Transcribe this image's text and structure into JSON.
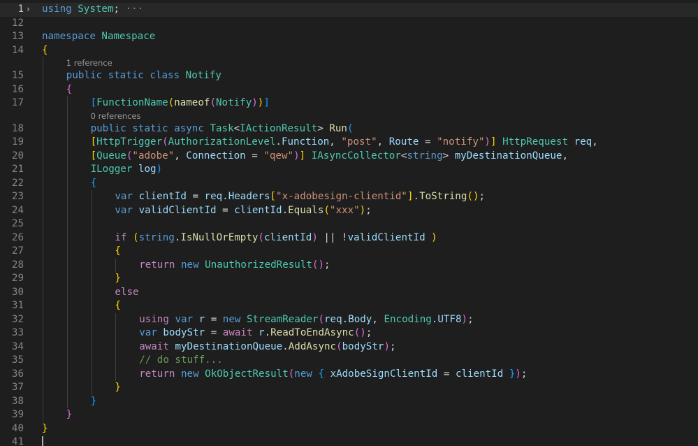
{
  "editor": {
    "lines": [
      {
        "no": "1",
        "fold": "›",
        "current": true,
        "indent": 0,
        "tokens": [
          [
            "kw",
            "using"
          ],
          [
            "pl",
            " "
          ],
          [
            "cls",
            "System"
          ],
          [
            "pl",
            ";"
          ],
          [
            "ell",
            " ···"
          ]
        ]
      },
      {
        "no": "12",
        "indent": 0,
        "tokens": []
      },
      {
        "no": "13",
        "indent": 0,
        "tokens": [
          [
            "kw",
            "namespace"
          ],
          [
            "pl",
            " "
          ],
          [
            "cls",
            "Namespace"
          ]
        ]
      },
      {
        "no": "14",
        "indent": 0,
        "tokens": [
          [
            "b1",
            "{"
          ]
        ]
      },
      {
        "lens": "1 reference",
        "indent": 1
      },
      {
        "no": "15",
        "indent": 1,
        "tokens": [
          [
            "kw",
            "public"
          ],
          [
            "pl",
            " "
          ],
          [
            "kw",
            "static"
          ],
          [
            "pl",
            " "
          ],
          [
            "kw",
            "class"
          ],
          [
            "pl",
            " "
          ],
          [
            "cls",
            "Notify"
          ]
        ]
      },
      {
        "no": "16",
        "indent": 1,
        "tokens": [
          [
            "b2",
            "{"
          ]
        ]
      },
      {
        "no": "17",
        "indent": 2,
        "tokens": [
          [
            "b3",
            "["
          ],
          [
            "cls",
            "FunctionName"
          ],
          [
            "b1",
            "("
          ],
          [
            "fn",
            "nameof"
          ],
          [
            "b2",
            "("
          ],
          [
            "cls",
            "Notify"
          ],
          [
            "b2",
            ")"
          ],
          [
            "b1",
            ")"
          ],
          [
            "b3",
            "]"
          ]
        ]
      },
      {
        "lens": "0 references",
        "indent": 2
      },
      {
        "no": "18",
        "indent": 2,
        "tokens": [
          [
            "kw",
            "public"
          ],
          [
            "pl",
            " "
          ],
          [
            "kw",
            "static"
          ],
          [
            "pl",
            " "
          ],
          [
            "kw",
            "async"
          ],
          [
            "pl",
            " "
          ],
          [
            "cls",
            "Task"
          ],
          [
            "pl",
            "<"
          ],
          [
            "cls",
            "IActionResult"
          ],
          [
            "pl",
            "> "
          ],
          [
            "fn",
            "Run"
          ],
          [
            "b3",
            "("
          ]
        ]
      },
      {
        "no": "19",
        "indent": 2,
        "tokens": [
          [
            "b1",
            "["
          ],
          [
            "cls",
            "HttpTrigger"
          ],
          [
            "b2",
            "("
          ],
          [
            "cls",
            "AuthorizationLevel"
          ],
          [
            "pl",
            "."
          ],
          [
            "var",
            "Function"
          ],
          [
            "pl",
            ", "
          ],
          [
            "str",
            "\"post\""
          ],
          [
            "pl",
            ", "
          ],
          [
            "var",
            "Route"
          ],
          [
            "pl",
            " = "
          ],
          [
            "str",
            "\"notify\""
          ],
          [
            "b2",
            ")"
          ],
          [
            "b1",
            "]"
          ],
          [
            "pl",
            " "
          ],
          [
            "cls",
            "HttpRequest"
          ],
          [
            "pl",
            " "
          ],
          [
            "var",
            "req"
          ],
          [
            "pl",
            ","
          ]
        ]
      },
      {
        "no": "20",
        "indent": 2,
        "tokens": [
          [
            "b1",
            "["
          ],
          [
            "cls",
            "Queue"
          ],
          [
            "b2",
            "("
          ],
          [
            "str",
            "\"adobe\""
          ],
          [
            "pl",
            ", "
          ],
          [
            "var",
            "Connection"
          ],
          [
            "pl",
            " = "
          ],
          [
            "str",
            "\"qew\""
          ],
          [
            "b2",
            ")"
          ],
          [
            "b1",
            "]"
          ],
          [
            "pl",
            " "
          ],
          [
            "cls",
            "IAsyncCollector"
          ],
          [
            "pl",
            "<"
          ],
          [
            "kw",
            "string"
          ],
          [
            "pl",
            "> "
          ],
          [
            "var",
            "myDestinationQueue"
          ],
          [
            "pl",
            ","
          ]
        ]
      },
      {
        "no": "21",
        "indent": 2,
        "tokens": [
          [
            "cls",
            "ILogger"
          ],
          [
            "pl",
            " "
          ],
          [
            "var",
            "log"
          ],
          [
            "b3",
            ")"
          ]
        ]
      },
      {
        "no": "22",
        "indent": 2,
        "tokens": [
          [
            "b3",
            "{"
          ]
        ]
      },
      {
        "no": "23",
        "indent": 3,
        "tokens": [
          [
            "kw",
            "var"
          ],
          [
            "pl",
            " "
          ],
          [
            "var",
            "clientId"
          ],
          [
            "pl",
            " = "
          ],
          [
            "var",
            "req"
          ],
          [
            "pl",
            "."
          ],
          [
            "var",
            "Headers"
          ],
          [
            "b1",
            "["
          ],
          [
            "str",
            "\"x-adobesign-clientid\""
          ],
          [
            "b1",
            "]"
          ],
          [
            "pl",
            "."
          ],
          [
            "fn",
            "ToString"
          ],
          [
            "b1",
            "()"
          ],
          [
            "pl",
            ";"
          ]
        ]
      },
      {
        "no": "24",
        "indent": 3,
        "tokens": [
          [
            "kw",
            "var"
          ],
          [
            "pl",
            " "
          ],
          [
            "var",
            "validClientId"
          ],
          [
            "pl",
            " = "
          ],
          [
            "var",
            "clientId"
          ],
          [
            "pl",
            "."
          ],
          [
            "fn",
            "Equals"
          ],
          [
            "b1",
            "("
          ],
          [
            "str",
            "\"xxx\""
          ],
          [
            "b1",
            ")"
          ],
          [
            "pl",
            ";"
          ]
        ]
      },
      {
        "no": "25",
        "indent": 3,
        "tokens": []
      },
      {
        "no": "26",
        "indent": 3,
        "tokens": [
          [
            "ctl",
            "if"
          ],
          [
            "pl",
            " "
          ],
          [
            "b1",
            "("
          ],
          [
            "kw",
            "string"
          ],
          [
            "pl",
            "."
          ],
          [
            "fn",
            "IsNullOrEmpty"
          ],
          [
            "b2",
            "("
          ],
          [
            "var",
            "clientId"
          ],
          [
            "b2",
            ")"
          ],
          [
            "pl",
            " || !"
          ],
          [
            "var",
            "validClientId"
          ],
          [
            "pl",
            " "
          ],
          [
            "b1",
            ")"
          ]
        ]
      },
      {
        "no": "27",
        "indent": 3,
        "tokens": [
          [
            "b1",
            "{"
          ]
        ]
      },
      {
        "no": "28",
        "indent": 4,
        "tokens": [
          [
            "ctl",
            "return"
          ],
          [
            "pl",
            " "
          ],
          [
            "kw",
            "new"
          ],
          [
            "pl",
            " "
          ],
          [
            "cls",
            "UnauthorizedResult"
          ],
          [
            "b2",
            "()"
          ],
          [
            "pl",
            ";"
          ]
        ]
      },
      {
        "no": "29",
        "indent": 3,
        "tokens": [
          [
            "b1",
            "}"
          ]
        ]
      },
      {
        "no": "30",
        "indent": 3,
        "tokens": [
          [
            "ctl",
            "else"
          ]
        ]
      },
      {
        "no": "31",
        "indent": 3,
        "tokens": [
          [
            "b1",
            "{"
          ]
        ]
      },
      {
        "no": "32",
        "indent": 4,
        "tokens": [
          [
            "ctl",
            "using"
          ],
          [
            "pl",
            " "
          ],
          [
            "kw",
            "var"
          ],
          [
            "pl",
            " "
          ],
          [
            "var",
            "r"
          ],
          [
            "pl",
            " = "
          ],
          [
            "kw",
            "new"
          ],
          [
            "pl",
            " "
          ],
          [
            "cls",
            "StreamReader"
          ],
          [
            "b2",
            "("
          ],
          [
            "var",
            "req"
          ],
          [
            "pl",
            "."
          ],
          [
            "var",
            "Body"
          ],
          [
            "pl",
            ", "
          ],
          [
            "cls",
            "Encoding"
          ],
          [
            "pl",
            "."
          ],
          [
            "var",
            "UTF8"
          ],
          [
            "b2",
            ")"
          ],
          [
            "pl",
            ";"
          ]
        ]
      },
      {
        "no": "33",
        "indent": 4,
        "tokens": [
          [
            "kw",
            "var"
          ],
          [
            "pl",
            " "
          ],
          [
            "var",
            "bodyStr"
          ],
          [
            "pl",
            " = "
          ],
          [
            "ctl",
            "await"
          ],
          [
            "pl",
            " "
          ],
          [
            "var",
            "r"
          ],
          [
            "pl",
            "."
          ],
          [
            "fn",
            "ReadToEndAsync"
          ],
          [
            "b2",
            "()"
          ],
          [
            "pl",
            ";"
          ]
        ]
      },
      {
        "no": "34",
        "indent": 4,
        "tokens": [
          [
            "ctl",
            "await"
          ],
          [
            "pl",
            " "
          ],
          [
            "var",
            "myDestinationQueue"
          ],
          [
            "pl",
            "."
          ],
          [
            "fn",
            "AddAsync"
          ],
          [
            "b2",
            "("
          ],
          [
            "var",
            "bodyStr"
          ],
          [
            "b2",
            ")"
          ],
          [
            "pl",
            ";"
          ]
        ]
      },
      {
        "no": "35",
        "indent": 4,
        "tokens": [
          [
            "com",
            "// do stuff..."
          ]
        ]
      },
      {
        "no": "36",
        "indent": 4,
        "tokens": [
          [
            "ctl",
            "return"
          ],
          [
            "pl",
            " "
          ],
          [
            "kw",
            "new"
          ],
          [
            "pl",
            " "
          ],
          [
            "cls",
            "OkObjectResult"
          ],
          [
            "b2",
            "("
          ],
          [
            "kw",
            "new"
          ],
          [
            "pl",
            " "
          ],
          [
            "b3",
            "{"
          ],
          [
            "pl",
            " "
          ],
          [
            "var",
            "xAdobeSignClientId"
          ],
          [
            "pl",
            " = "
          ],
          [
            "var",
            "clientId"
          ],
          [
            "pl",
            " "
          ],
          [
            "b3",
            "}"
          ],
          [
            "b2",
            ")"
          ],
          [
            "pl",
            ";"
          ]
        ]
      },
      {
        "no": "37",
        "indent": 3,
        "tokens": [
          [
            "b1",
            "}"
          ]
        ]
      },
      {
        "no": "38",
        "indent": 2,
        "tokens": [
          [
            "b3",
            "}"
          ]
        ]
      },
      {
        "no": "39",
        "indent": 1,
        "tokens": [
          [
            "b2",
            "}"
          ]
        ]
      },
      {
        "no": "40",
        "indent": 0,
        "tokens": [
          [
            "b1",
            "}"
          ]
        ]
      },
      {
        "no": "41",
        "indent": 0,
        "tokens": [],
        "cursor": true
      }
    ]
  }
}
